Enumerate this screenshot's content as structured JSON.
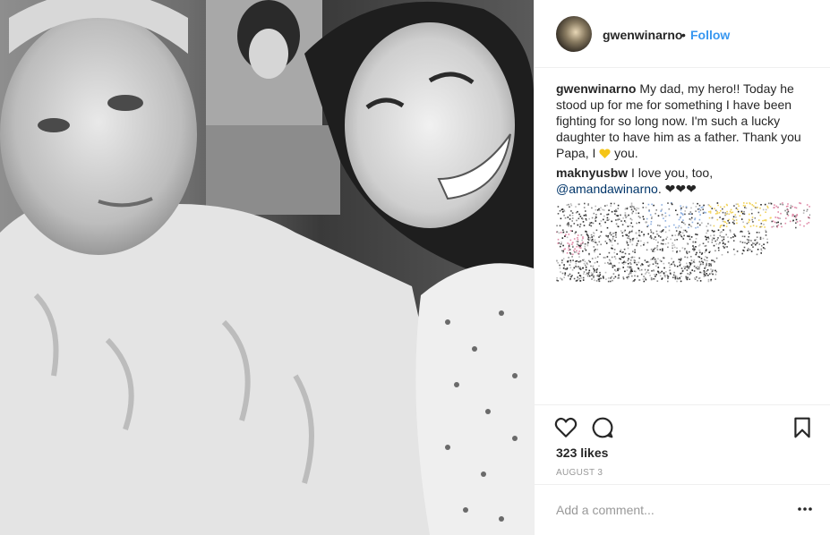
{
  "post": {
    "username": "gwenwinarno",
    "separator": "•",
    "follow_label": "Follow",
    "avatar_icon": "profile-avatar",
    "photo_description_icon": "photo"
  },
  "comments": [
    {
      "user": "gwenwinarno",
      "text_before": "My dad, my hero!! Today he stood up for me for something I have been fighting for so long now. I'm such a lucky daughter to have him as a father. Thank you Papa, I",
      "emoji": "yellow-heart-icon",
      "text_after": "you."
    },
    {
      "user": "maknyusbw",
      "text_before": "I love you, too,",
      "mention": "@amandawinarno",
      "text_after": ". ❤❤❤"
    }
  ],
  "actions": {
    "like_icon": "heart-outline-icon",
    "comment_icon": "comment-icon",
    "save_icon": "bookmark-icon"
  },
  "likes": "323 likes",
  "date": "AUGUST 3",
  "add_comment": {
    "placeholder": "Add a comment...",
    "more_icon": "more-options-icon"
  },
  "colors": {
    "link_blue": "#3897f0",
    "mention_blue": "#003569",
    "text": "#262626",
    "muted": "#999999",
    "divider": "#efefef"
  }
}
